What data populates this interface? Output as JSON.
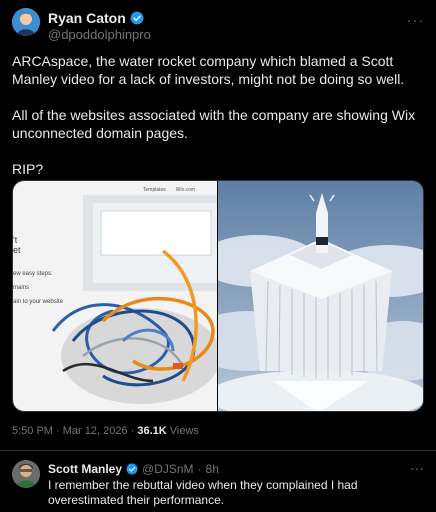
{
  "post": {
    "display_name": "Ryan Caton",
    "handle": "@dpoddolphinpro",
    "paragraphs": [
      "ARCAspace, the water rocket company which blamed a Scott Manley video for a lack of investors, might not be doing so well.",
      "All of the websites associated with the company are showing Wix unconnected domain pages.",
      "RIP?"
    ],
    "timestamp": "5:50 PM · Mar 12, 2026 · ",
    "views_count": "36.1K",
    "views_label": " Views",
    "more_icon": "more-horizontal-icon",
    "verified_color": "#1d9bf0"
  },
  "media": {
    "left_nav": [
      "Templates",
      "Wix.com"
    ],
    "left_text": [
      "'t",
      "et",
      "ew easy steps:",
      "mains",
      "ain to your website"
    ]
  },
  "reply": {
    "display_name": "Scott Manley",
    "handle": "@DJSnM",
    "separator": "·",
    "age": "8h",
    "text": "I remember the rebuttal video when they complained I had overestimated their performance."
  }
}
